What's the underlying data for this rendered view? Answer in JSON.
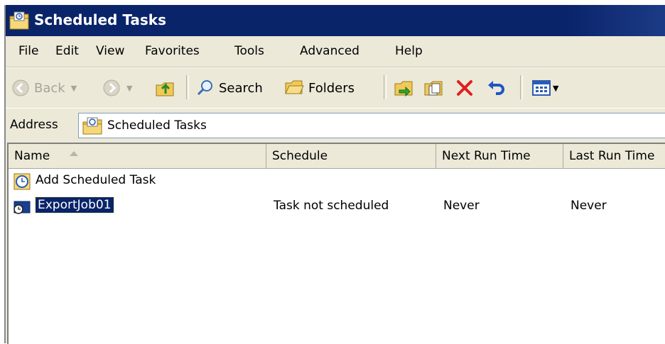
{
  "window": {
    "title": "Scheduled Tasks"
  },
  "menu": {
    "items": [
      "File",
      "Edit",
      "View",
      "Favorites",
      "Tools",
      "Advanced",
      "Help"
    ]
  },
  "toolbar": {
    "back_label": "Back",
    "search_label": "Search",
    "folders_label": "Folders",
    "icons": [
      "back-icon",
      "forward-icon",
      "up-folder-icon",
      "search-icon",
      "folders-icon",
      "move-to-icon",
      "copy-to-icon",
      "delete-icon",
      "undo-icon",
      "views-icon"
    ]
  },
  "address": {
    "label": "Address",
    "value": "Scheduled Tasks"
  },
  "list": {
    "columns": [
      "Name",
      "Schedule",
      "Next Run Time",
      "Last Run Time"
    ],
    "rows": [
      {
        "name": "Add Scheduled Task",
        "schedule": "",
        "next_run": "",
        "last_run": "",
        "selected": false,
        "icon": "add-task-icon"
      },
      {
        "name": "ExportJob01",
        "schedule": "Task not scheduled",
        "next_run": "Never",
        "last_run": "Never",
        "selected": true,
        "icon": "task-icon"
      }
    ]
  },
  "colors": {
    "titlebar": "#0a246a",
    "selection": "#0a246a",
    "chrome": "#ece9d8",
    "delete": "#e02020"
  }
}
